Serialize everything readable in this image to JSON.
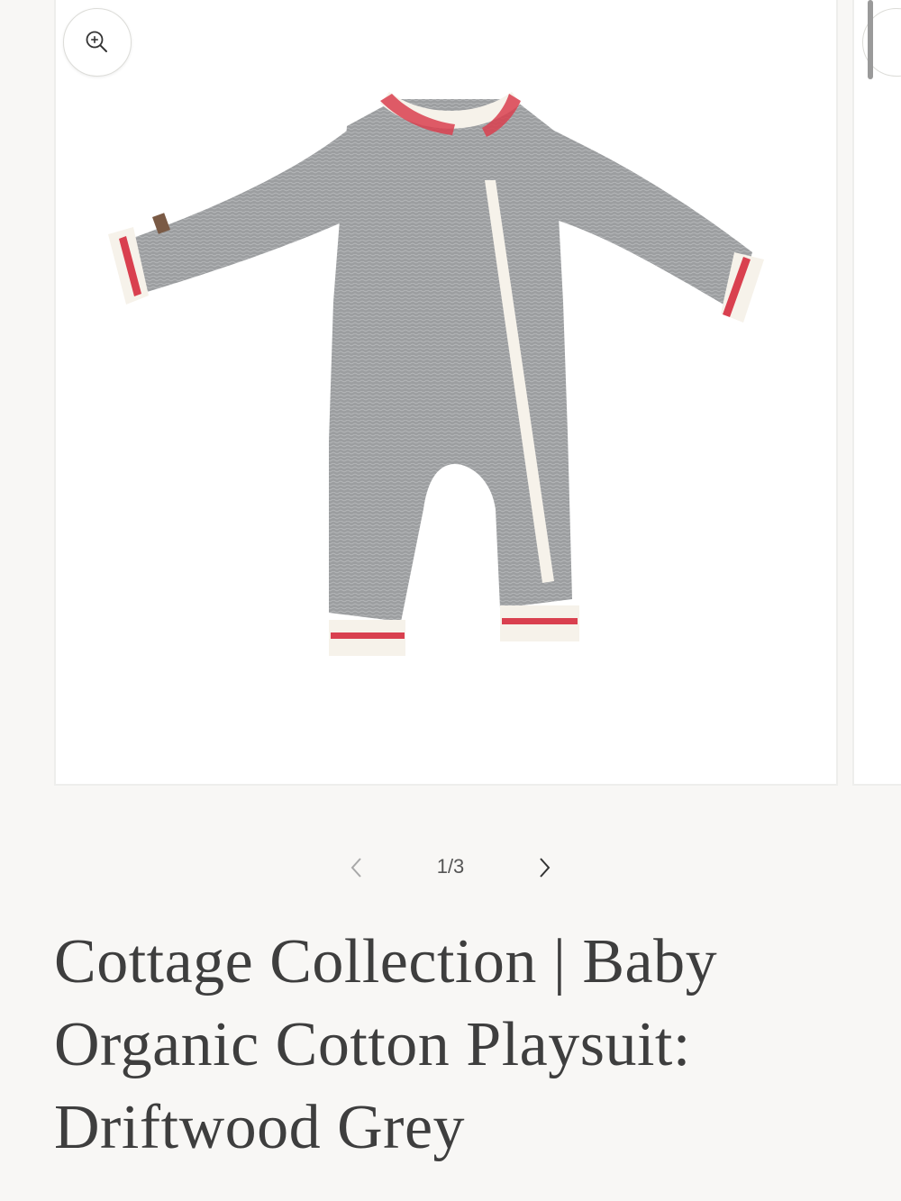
{
  "gallery": {
    "zoom_icon": "zoom-in-icon",
    "image_name": "baby-playsuit-image",
    "current_page": 1,
    "total_pages": 3,
    "counter": "1/3",
    "prev_icon": "chevron-left-icon",
    "next_icon": "chevron-right-icon"
  },
  "product": {
    "title_line1": "Cottage Collection | Baby",
    "title_line2": "Organic Cotton Playsuit:",
    "title_line3": "Driftwood Grey"
  },
  "colors": {
    "background": "#f8f7f5",
    "card": "#ffffff",
    "garment_grey": "#9a9c9e",
    "trim_red": "#d9404f",
    "trim_cream": "#f6f2ea",
    "title_text": "#3e3e3e"
  }
}
